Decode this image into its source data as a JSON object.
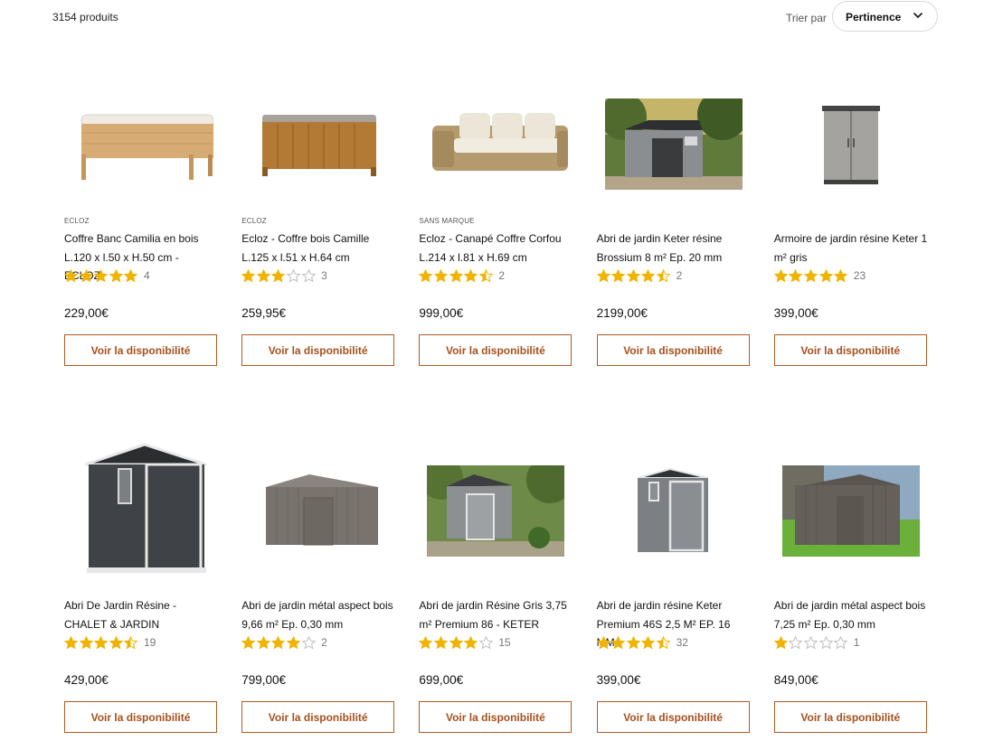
{
  "header": {
    "product_count": "3154 produits",
    "sort_label": "Trier par",
    "sort_value": "Pertinence"
  },
  "colors": {
    "star": "#f0b400",
    "star_empty": "#bdbdbd",
    "button_accent": "#a6501d"
  },
  "products": [
    {
      "brand": "ECLOZ",
      "title": "Coffre Banc Camilia en bois L.120 x l.50 x H.50 cm - ECLOZ",
      "rating": 5,
      "reviews": "4",
      "price": "229,00€",
      "button": "Voir la disponibilité",
      "image": "wooden-storage-bench-image"
    },
    {
      "brand": "ECLOZ",
      "title": "Ecloz - Coffre bois Camille L.125 x l.51 x H.64 cm",
      "rating": 3,
      "reviews": "3",
      "price": "259,95€",
      "button": "Voir la disponibilité",
      "image": "wooden-storage-chest-image"
    },
    {
      "brand": "SANS MARQUE",
      "title": "Ecloz - Canapé Coffre Corfou L.214 x l.81 x H.69 cm",
      "rating": 4.5,
      "reviews": "2",
      "price": "999,00€",
      "button": "Voir la disponibilité",
      "image": "rattan-sofa-image"
    },
    {
      "brand": "",
      "title": "Abri de jardin Keter résine Brossium 8 m² Ep. 20 mm",
      "rating": 4.5,
      "reviews": "2",
      "price": "2199,00€",
      "button": "Voir la disponibilité",
      "image": "resin-shed-garden-photo"
    },
    {
      "brand": "",
      "title": "Armoire de jardin résine Keter 1 m² gris",
      "rating": 5,
      "reviews": "23",
      "price": "399,00€",
      "button": "Voir la disponibilité",
      "image": "resin-cabinet-image"
    },
    {
      "brand": "",
      "title": "Abri De Jardin Résine - CHALET & JARDIN",
      "rating": 4.5,
      "reviews": "19",
      "price": "429,00€",
      "button": "Voir la disponibilité",
      "image": "dark-resin-shed-image"
    },
    {
      "brand": "",
      "title": "Abri de jardin métal aspect bois 9,66 m² Ep. 0,30 mm",
      "rating": 4,
      "reviews": "2",
      "price": "799,00€",
      "button": "Voir la disponibilité",
      "image": "metal-shed-image"
    },
    {
      "brand": "",
      "title": "Abri de jardin Résine Gris 3,75 m² Premium 86 - KETER",
      "rating": 4,
      "reviews": "15",
      "price": "699,00€",
      "button": "Voir la disponibilité",
      "image": "grey-resin-shed-garden-photo"
    },
    {
      "brand": "",
      "title": "Abri de jardin résine Keter Premium 46S 2,5 M² EP. 16 MM",
      "rating": 4.5,
      "reviews": "32",
      "price": "399,00€",
      "button": "Voir la disponibilité",
      "image": "grey-resin-shed-image"
    },
    {
      "brand": "",
      "title": "Abri de jardin métal aspect bois 7,25 m² Ep. 0,30 mm",
      "rating": 1,
      "reviews": "1",
      "price": "849,00€",
      "button": "Voir la disponibilité",
      "image": "metal-shed-lawn-photo"
    }
  ]
}
